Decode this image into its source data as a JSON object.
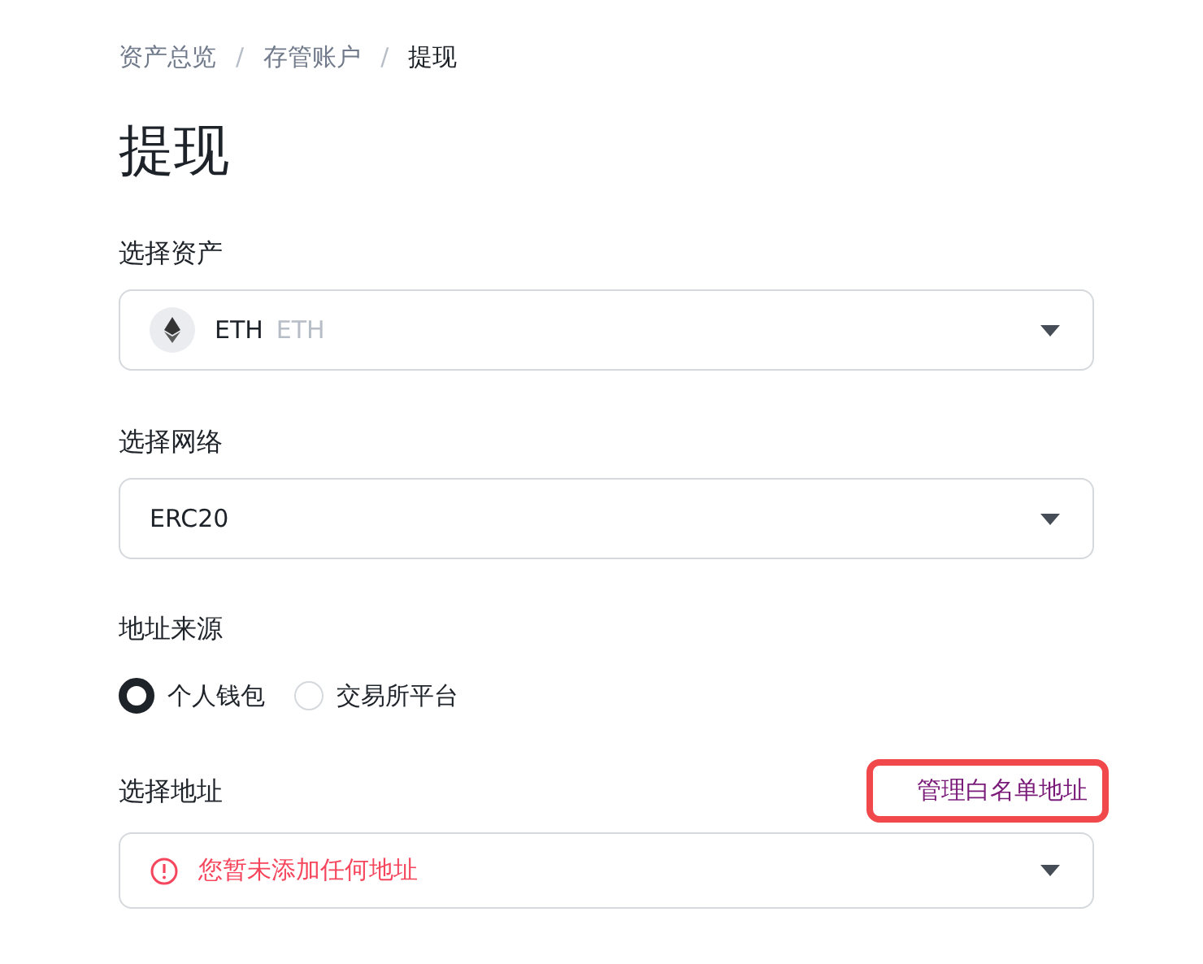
{
  "breadcrumb": [
    {
      "label": "资产总览",
      "current": false
    },
    {
      "separator": "/",
      "label": "存管账户",
      "current": false
    },
    {
      "separator": "/",
      "label": "提现",
      "current": true
    }
  ],
  "title": "提现",
  "asset": {
    "label": "选择资产",
    "symbol": "ETH",
    "name": "ETH"
  },
  "network": {
    "label": "选择网络",
    "value": "ERC20"
  },
  "source": {
    "label": "地址来源",
    "options": [
      {
        "label": "个人钱包",
        "selected": true
      },
      {
        "label": "交易所平台",
        "selected": false
      }
    ]
  },
  "address": {
    "label": "选择地址",
    "manage_link": {
      "label": "管理白名单地址",
      "highlighted": true
    },
    "error": "您暂未添加任何地址"
  }
}
